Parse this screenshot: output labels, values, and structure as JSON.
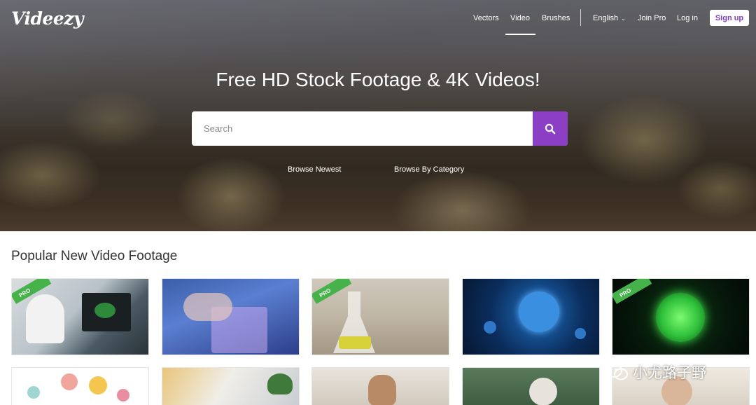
{
  "brand": {
    "logo": "Videezy"
  },
  "nav": {
    "vectors": "Vectors",
    "video": "Video",
    "brushes": "Brushes",
    "language": "English",
    "join_pro": "Join Pro",
    "login": "Log in",
    "signup": "Sign up"
  },
  "hero": {
    "title": "Free HD Stock Footage & 4K Videos!",
    "search_placeholder": "Search",
    "browse_newest": "Browse Newest",
    "browse_category": "Browse By Category"
  },
  "section": {
    "title": "Popular New Video Footage"
  },
  "thumbnails": [
    {
      "subject": "scientist-microscope",
      "pro": true,
      "badge": "PRO"
    },
    {
      "subject": "lab-test-tubes",
      "pro": false
    },
    {
      "subject": "lab-flask",
      "pro": true,
      "badge": "PRO"
    },
    {
      "subject": "blue-virus",
      "pro": false
    },
    {
      "subject": "green-virus",
      "pro": true,
      "badge": "PRO"
    },
    {
      "subject": "infographic-icons",
      "pro": false
    },
    {
      "subject": "laptop-typing",
      "pro": false
    },
    {
      "subject": "man-smiling",
      "pro": false
    },
    {
      "subject": "woman-mask-greenhouse",
      "pro": false
    },
    {
      "subject": "woman-mask",
      "pro": false
    }
  ],
  "watermark": {
    "text": "小尤路子野"
  },
  "colors": {
    "accent": "#8a3fc4",
    "pro_badge": "#46b24a"
  }
}
